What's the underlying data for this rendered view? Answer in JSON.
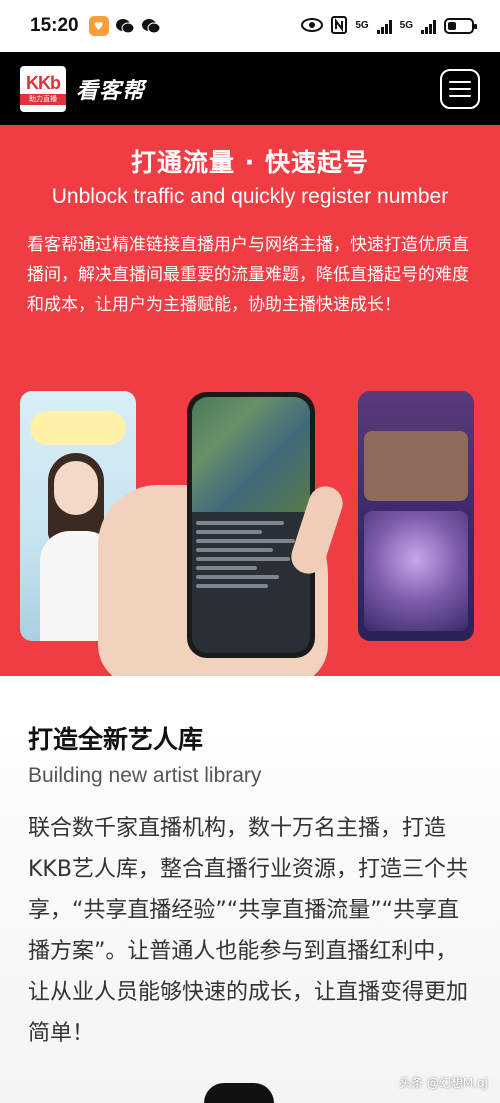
{
  "status_bar": {
    "time": "15:20",
    "network_1": "5G",
    "network_2": "5G"
  },
  "header": {
    "logo_text": "KKb",
    "logo_subtext": "助力直播",
    "brand_name": "看客帮"
  },
  "hero": {
    "title": "打通流量 · 快速起号",
    "subtitle": "Unblock traffic and quickly register number",
    "description": "看客帮通过精准链接直播用户与网络主播，快速打造优质直播间，解决直播间最重要的流量难题，降低直播起号的难度和成本，让用户为主播赋能，协助主播快速成长！",
    "background_color": "#f03d43"
  },
  "artist_section": {
    "title": "打造全新艺人库",
    "subtitle": "Building new artist library",
    "description": "联合数千家直播机构，数十万名主播，打造KKB艺人库，整合直播行业资源，打造三个共享，“共享直播经验”“共享直播流量”“共享直播方案”。让普通人也能参与到直播红利中，让从业人员能够快速的成长，让直播变得更加简单！"
  },
  "watermark": "头条 @幻想M.qj"
}
